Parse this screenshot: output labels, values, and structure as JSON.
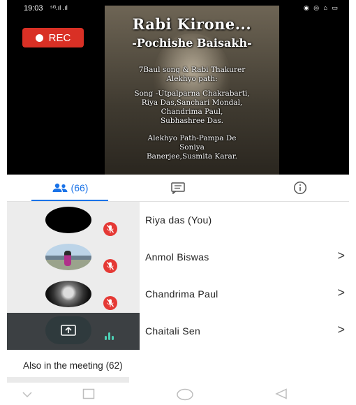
{
  "status_bar": {
    "time": "19:03",
    "signal_text": "⁵ᴳ.ıl .ıl",
    "right_icons": "◉ ◎ ⌂ ▭"
  },
  "recording": {
    "label": "REC",
    "color": "#d93025"
  },
  "shared_screen": {
    "title": "Rabi Kirone...",
    "subtitle": "-Pochishe Baisakh-",
    "description_lines": [
      "7Baul song & Rabi Thakurer",
      "Alekhyo  path:"
    ],
    "song_credits": [
      "Song -Utpalparna Chakrabarti,",
      "Riya Das,Sanchari Mondal,",
      "Chandrima Paul,",
      "Subhashree Das."
    ],
    "path_credits": [
      "Alekhyo Path-Pampa De",
      "Soniya",
      "Banerjee,Susmita Karar."
    ]
  },
  "tabs": {
    "people_count": "(66)",
    "accent_color": "#1a73e8",
    "icons": [
      "people-icon",
      "chat-icon",
      "info-icon"
    ]
  },
  "participants": [
    {
      "name": "Riya das (You)",
      "muted": true,
      "avatar": "black"
    },
    {
      "name": "Anmol Biswas",
      "muted": true,
      "avatar": "photo"
    },
    {
      "name": "Chandrima Paul",
      "muted": true,
      "avatar": "photo"
    },
    {
      "name": "Chaitali Sen",
      "muted": false,
      "avatar": "presenting"
    }
  ],
  "also_in_meeting": "Also in the meeting (62)",
  "nav_icons": [
    "chevron-down-icon",
    "square-icon",
    "circle-home-icon",
    "triangle-back-icon"
  ]
}
